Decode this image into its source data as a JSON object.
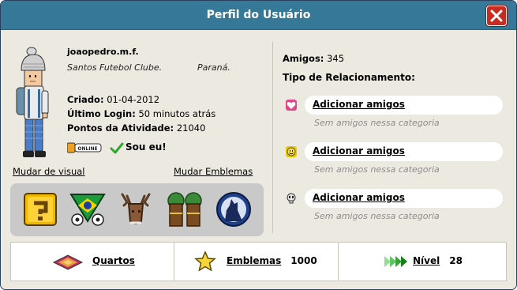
{
  "window": {
    "title": "Perfil do Usuário"
  },
  "profile": {
    "username": "joaopedro.m.f.",
    "motto_left": "Santos Futebol Clube.",
    "motto_right": "Paraná.",
    "created_label": "Criado:",
    "created_value": "01-04-2012",
    "last_login_label": "Último Login:",
    "last_login_value": "50 minutos atrás",
    "activity_label": "Pontos da Atividade:",
    "activity_value": "21040",
    "online_badge": "ONLINE",
    "self_label": "Sou eu!",
    "change_look_link": "Mudar de visual",
    "change_badges_link": "Mudar Emblemas",
    "badges": [
      "question-block-badge",
      "brazil-football-badge",
      "moose-badge",
      "forest-badge",
      "wolf-moon-badge"
    ]
  },
  "relationships": {
    "friends_label": "Amigos:",
    "friends_count": "345",
    "heading": "Tipo de Relacionamento:",
    "items": [
      {
        "icon": "heart-icon",
        "link": "Adicionar amigos",
        "empty": "Sem amigos nessa categoria",
        "color": "#e0478a"
      },
      {
        "icon": "smile-icon",
        "link": "Adicionar amigos",
        "empty": "Sem amigos nessa categoria",
        "color": "#e8c800"
      },
      {
        "icon": "skull-icon",
        "link": "Adicionar amigos",
        "empty": "Sem amigos nessa categoria",
        "color": "#9a9a9a"
      }
    ]
  },
  "footer": {
    "rooms_label": "Quartos",
    "badges_label": "Emblemas",
    "badges_count": "1000",
    "level_label": "Nível",
    "level_value": "28"
  },
  "colors": {
    "titlebar": "#367897",
    "close": "#c92b20",
    "panel": "#eceae0"
  }
}
